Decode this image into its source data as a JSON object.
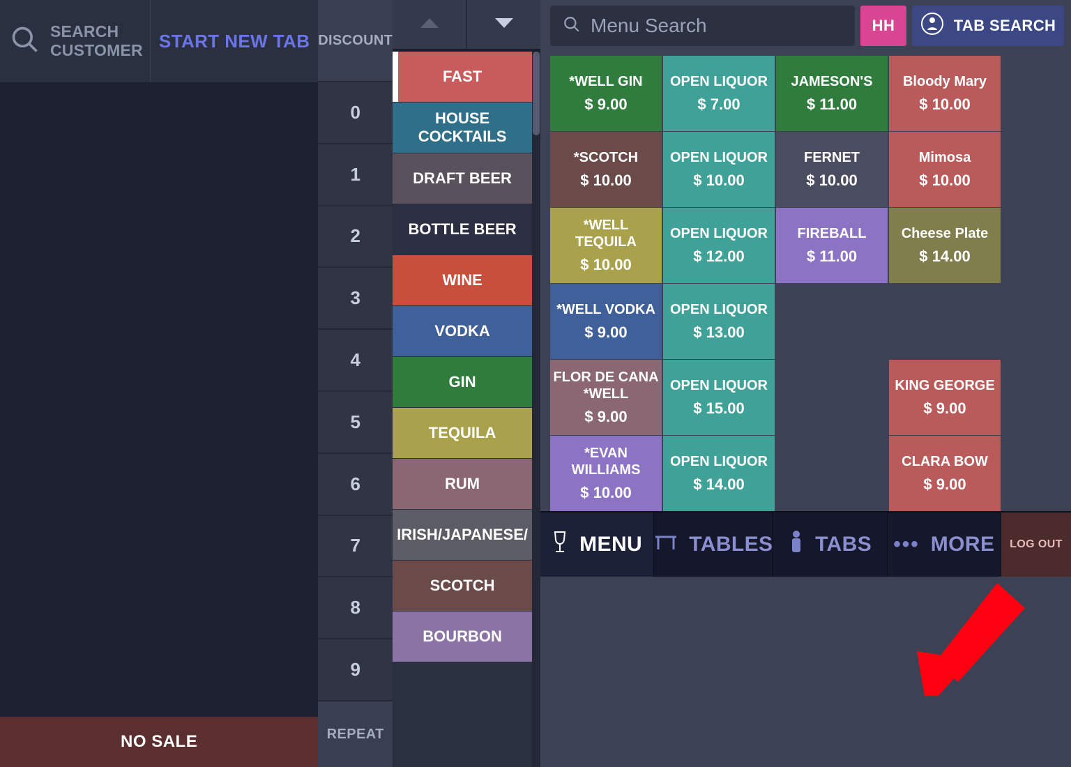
{
  "order": {
    "search_customer_line1": "SEARCH",
    "search_customer_line2": "CUSTOMER",
    "start_new_tab": "START NEW TAB",
    "no_sale": "NO SALE"
  },
  "side": {
    "discount": "DISCOUNT",
    "keys": [
      "0",
      "1",
      "2",
      "3",
      "4",
      "5",
      "6",
      "7",
      "8",
      "9"
    ],
    "repeat": "REPEAT"
  },
  "search": {
    "placeholder": "Menu Search",
    "hh": "HH",
    "tab_search": "TAB SEARCH"
  },
  "cats": [
    {
      "label": "FAST",
      "bg": "#c85b5b",
      "active": true
    },
    {
      "label": "HOUSE COCKTAILS",
      "bg": "#2f6f89"
    },
    {
      "label": "DRAFT BEER",
      "bg": "#59525c"
    },
    {
      "label": "BOTTLE BEER",
      "bg": "#2b2f41"
    },
    {
      "label": "WINE",
      "bg": "#c84f3b"
    },
    {
      "label": "VODKA",
      "bg": "#40609a"
    },
    {
      "label": "GIN",
      "bg": "#2f7c3d"
    },
    {
      "label": "TEQUILA",
      "bg": "#a9a14b"
    },
    {
      "label": "RUM",
      "bg": "#8b6774"
    },
    {
      "label": "IRISH/JAPANESE/",
      "bg": "#5c5c66"
    },
    {
      "label": "SCOTCH",
      "bg": "#6b4a4a"
    },
    {
      "label": "BOURBON",
      "bg": "#8c73a5"
    }
  ],
  "items": [
    {
      "name": "*WELL GIN",
      "price": "$ 9.00",
      "bg": "#2f7c3d"
    },
    {
      "name": "OPEN LIQUOR",
      "price": "$ 7.00",
      "bg": "#3fa197"
    },
    {
      "name": "JAMESON'S",
      "price": "$ 11.00",
      "bg": "#2f7c3d"
    },
    {
      "name": "Bloody Mary",
      "price": "$ 10.00",
      "bg": "#b95b5b"
    },
    {
      "name": "*SCOTCH",
      "price": "$ 10.00",
      "bg": "#6b4a4a"
    },
    {
      "name": "OPEN LIQUOR",
      "price": "$ 10.00",
      "bg": "#3fa197"
    },
    {
      "name": "FERNET",
      "price": "$ 10.00",
      "bg": "#4a4d5f"
    },
    {
      "name": "Mimosa",
      "price": "$ 10.00",
      "bg": "#b95b5b"
    },
    {
      "name": "*WELL TEQUILA",
      "price": "$ 10.00",
      "bg": "#a9a14b"
    },
    {
      "name": "OPEN LIQUOR",
      "price": "$ 12.00",
      "bg": "#3fa197"
    },
    {
      "name": "FIREBALL",
      "price": "$ 11.00",
      "bg": "#8c73c3"
    },
    {
      "name": "Cheese Plate",
      "price": "$ 14.00",
      "bg": "#817e4e"
    },
    {
      "name": "*WELL VODKA",
      "price": "$ 9.00",
      "bg": "#40609a"
    },
    {
      "name": "OPEN LIQUOR",
      "price": "$ 13.00",
      "bg": "#3fa197"
    },
    {
      "empty": true
    },
    {
      "empty": true
    },
    {
      "name": "FLOR DE CANA *WELL",
      "price": "$ 9.00",
      "bg": "#8b6774"
    },
    {
      "name": "OPEN LIQUOR",
      "price": "$ 15.00",
      "bg": "#3fa197"
    },
    {
      "empty": true
    },
    {
      "name": "KING GEORGE",
      "price": "$ 9.00",
      "bg": "#b95b5b"
    },
    {
      "name": "*EVAN WILLIAMS",
      "price": "$ 10.00",
      "bg": "#8c73c3"
    },
    {
      "name": "OPEN LIQUOR",
      "price": "$ 14.00",
      "bg": "#3fa197"
    },
    {
      "empty": true
    },
    {
      "name": "CLARA BOW",
      "price": "$ 9.00",
      "bg": "#b95b5b"
    }
  ],
  "nav": {
    "menu": "MENU",
    "tables": "TABLES",
    "tabs": "TABS",
    "more": "MORE",
    "logout": "LOG OUT"
  }
}
